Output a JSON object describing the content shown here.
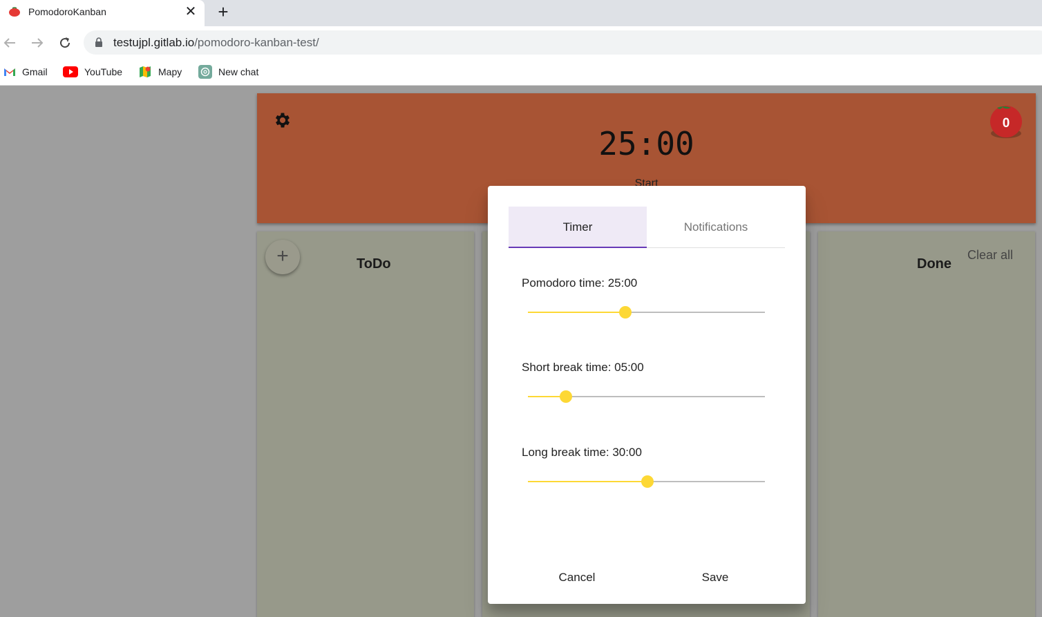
{
  "browser": {
    "tab_title": "PomodoroKanban",
    "tab_close": "✕",
    "new_tab": "+",
    "url_host": "testujpl.gitlab.io",
    "url_path": "/pomodoro-kanban-test/",
    "bookmarks": [
      {
        "label": "Gmail",
        "icon": "gmail-icon"
      },
      {
        "label": "YouTube",
        "icon": "youtube-icon"
      },
      {
        "label": "Mapy",
        "icon": "maps-icon"
      },
      {
        "label": "New chat",
        "icon": "chatgpt-icon"
      }
    ]
  },
  "app": {
    "timer": "25:00",
    "start_label": "Start",
    "pomodoro_count": "0",
    "columns": {
      "todo_title": "ToDo",
      "done_title": "Done",
      "add_label": "+",
      "clear_all_label": "Clear all"
    }
  },
  "dialog": {
    "tabs": {
      "timer": "Timer",
      "notifications": "Notifications"
    },
    "sliders": [
      {
        "label": "Pomodoro time: 25:00",
        "fraction": 0.41
      },
      {
        "label": "Short break time: 05:00",
        "fraction": 0.16
      },
      {
        "label": "Long break time: 30:00",
        "fraction": 0.505
      }
    ],
    "cancel_label": "Cancel",
    "save_label": "Save"
  },
  "colors": {
    "header": "#a85434",
    "column": "#97998a",
    "slider_accent": "#fdd835",
    "tab_indicator": "#673ab7"
  }
}
